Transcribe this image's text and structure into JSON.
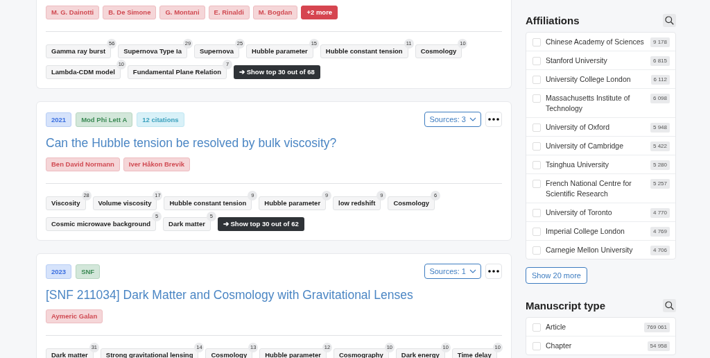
{
  "papers": [
    {
      "authors": [
        "M. G. Dainotti",
        "B. De Simone",
        "G. Montani",
        "E. Rinaldi",
        "M. Bogdan"
      ],
      "more_authors": "+2 more",
      "keywords": [
        {
          "label": "Gamma ray burst",
          "count": "56"
        },
        {
          "label": "Supernova Type Ia",
          "count": "29"
        },
        {
          "label": "Supernova",
          "count": "25"
        },
        {
          "label": "Hubble parameter",
          "count": "15"
        },
        {
          "label": "Hubble constant tension",
          "count": "11"
        },
        {
          "label": "Cosmology",
          "count": "10"
        },
        {
          "label": "Lambda-CDM model",
          "count": "10"
        },
        {
          "label": "Fundamental Plane Relation",
          "count": "7"
        }
      ],
      "show_top": "➔ Show top 30 out of 68"
    },
    {
      "badges": [
        {
          "kind": "year",
          "text": "2021"
        },
        {
          "kind": "journal",
          "text": "Mod Phi Lett A"
        },
        {
          "kind": "citations",
          "text": "12 citations"
        }
      ],
      "sources": "Sources: 3",
      "title": "Can the Hubble tension be resolved by bulk viscosity?",
      "authors": [
        "Ben David Normann",
        "Iver Håkon Brevik"
      ],
      "keywords": [
        {
          "label": "Viscosity",
          "count": "28"
        },
        {
          "label": "Volume viscosity",
          "count": "17"
        },
        {
          "label": "Hubble constant tension",
          "count": "9"
        },
        {
          "label": "Hubble parameter",
          "count": "9"
        },
        {
          "label": "low redshift",
          "count": "9"
        },
        {
          "label": "Cosmology",
          "count": "6"
        },
        {
          "label": "Cosmic microwave background",
          "count": "5"
        },
        {
          "label": "Dark matter",
          "count": "5"
        }
      ],
      "show_top": "➔ Show top 30 out of 62"
    },
    {
      "badges": [
        {
          "kind": "year",
          "text": "2023"
        },
        {
          "kind": "journal",
          "text": "SNF"
        }
      ],
      "sources": "Sources: 1",
      "title": "[SNF 211034] Dark Matter and Cosmology with Gravitational Lenses",
      "authors": [
        "Aymeric Galan"
      ],
      "keywords": [
        {
          "label": "Dark matter",
          "count": "31"
        },
        {
          "label": "Strong gravitational lensing",
          "count": "14"
        },
        {
          "label": "Cosmology",
          "count": "13"
        },
        {
          "label": "Hubble parameter",
          "count": "12"
        },
        {
          "label": "Cosmography",
          "count": "10"
        },
        {
          "label": "Dark energy",
          "count": "10"
        },
        {
          "label": "Time delay",
          "count": "10"
        }
      ]
    }
  ],
  "filters": [
    {
      "title": "Affiliations",
      "items": [
        {
          "label": "Chinese Academy of Sciences",
          "count": "9 178",
          "checked": false
        },
        {
          "label": "Stanford University",
          "count": "6 815",
          "checked": false
        },
        {
          "label": "University College London",
          "count": "6 112",
          "checked": false
        },
        {
          "label": "Massachusetts Institute of Technology",
          "count": "6 098",
          "checked": false
        },
        {
          "label": "University of Oxford",
          "count": "5 948",
          "checked": false
        },
        {
          "label": "University of Cambridge",
          "count": "5 422",
          "checked": false
        },
        {
          "label": "Tsinghua University",
          "count": "5 280",
          "checked": false
        },
        {
          "label": "French National Centre for Scientific Research",
          "count": "5 257",
          "checked": false
        },
        {
          "label": "University of Toronto",
          "count": "4 770",
          "checked": false
        },
        {
          "label": "Imperial College London",
          "count": "4 769",
          "checked": false
        },
        {
          "label": "Carnegie Mellon University",
          "count": "4 706",
          "checked": false
        }
      ],
      "more": "Show 20 more"
    },
    {
      "title": "Manuscript type",
      "items": [
        {
          "label": "Article",
          "count": "769 061",
          "checked": false
        },
        {
          "label": "Chapter",
          "count": "54 958",
          "checked": false
        }
      ]
    }
  ]
}
